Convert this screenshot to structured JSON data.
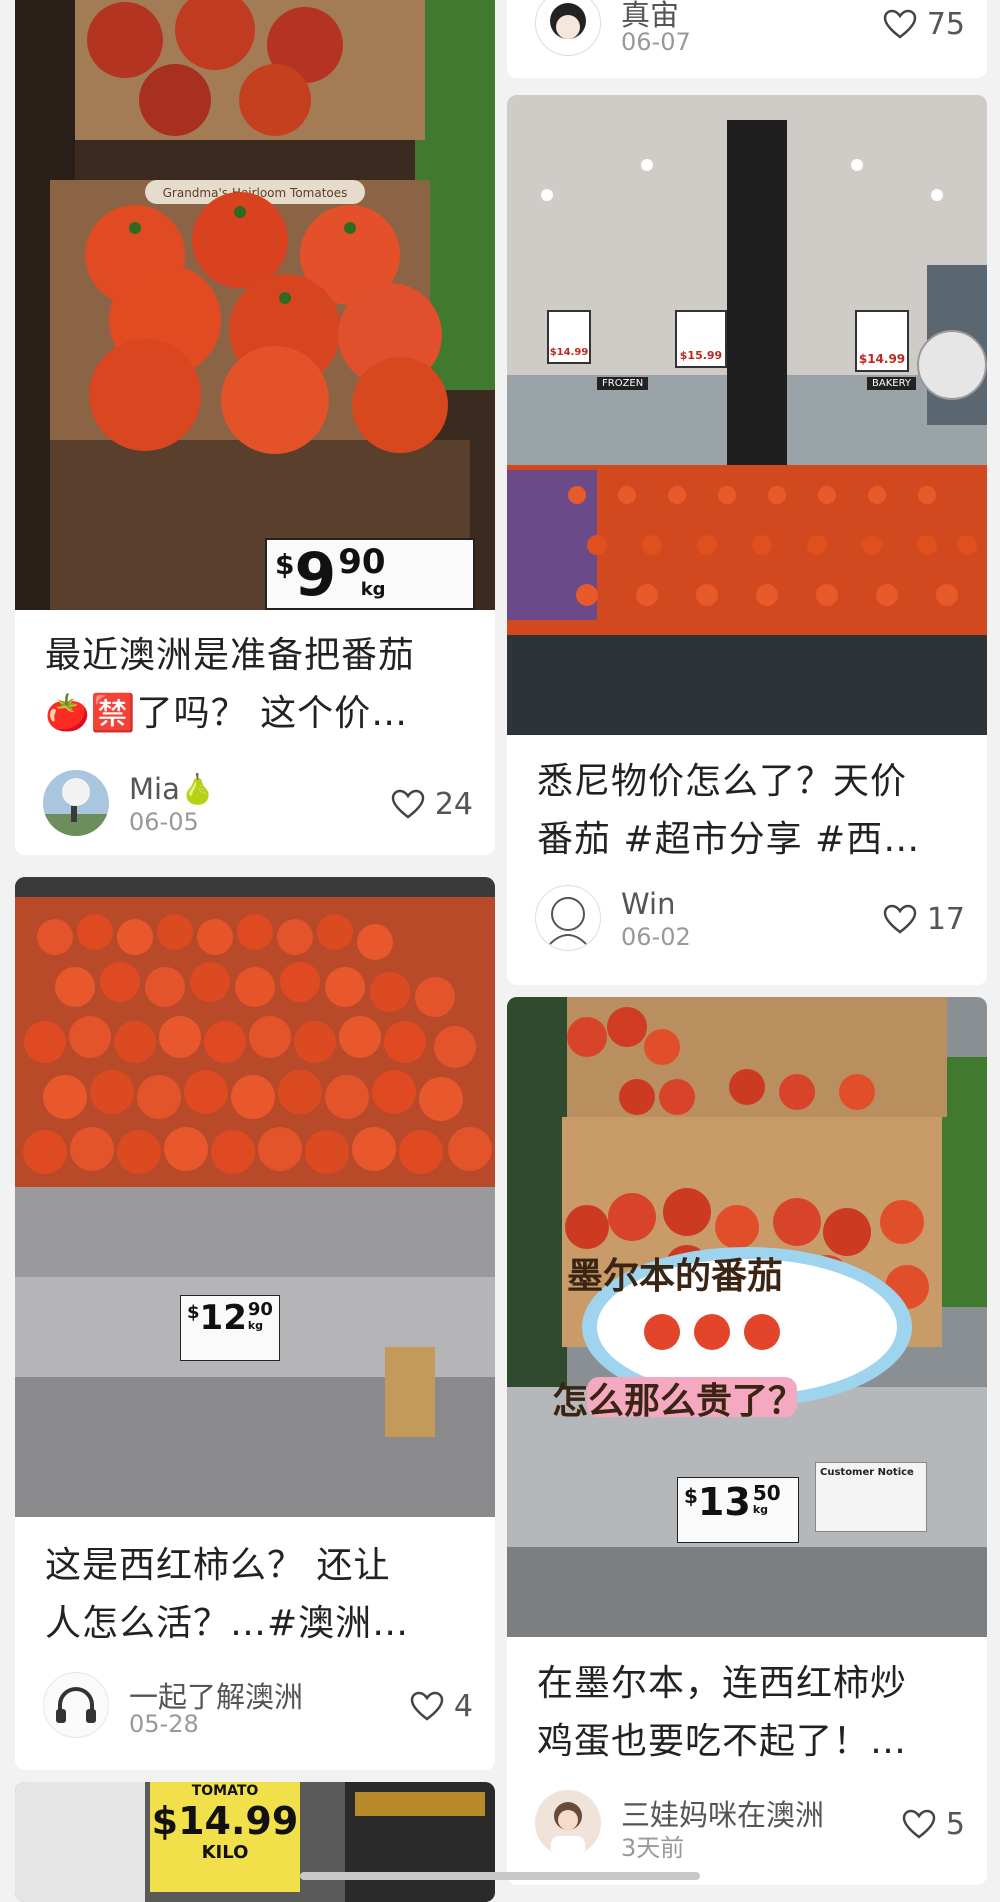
{
  "feed": {
    "left": [
      {
        "title": "最近澳洲是准备把番茄\n🍅🈲了吗？ 这个价…",
        "author": "Mia🍐",
        "date": "06-05",
        "likes": "24",
        "price": {
          "dollar": "$",
          "main": "9",
          "cents": "90",
          "unit": "kg"
        },
        "box_label": "Grandma's Heirloom Tomatoes"
      },
      {
        "title": "这是西红柿么？ 还让\n人怎么活？…#澳洲…",
        "author": "一起了解澳洲",
        "date": "05-28",
        "likes": "4",
        "price": {
          "dollar": "$",
          "main": "12",
          "cents": "90",
          "unit": "kg"
        }
      },
      {
        "price": {
          "label": "TOMATO",
          "main": "$14.99",
          "unit": "KILO"
        }
      }
    ],
    "right": [
      {
        "author": "真宙",
        "date": "06-07",
        "likes": "75"
      },
      {
        "title": "悉尼物价怎么了？天价\n番茄 #超市分享 #西…",
        "author": "Win",
        "date": "06-02",
        "likes": "17",
        "signs": [
          "$14.99",
          "$15.99",
          "$14.99"
        ],
        "store_labels": [
          "FROZEN",
          "BAKERY"
        ]
      },
      {
        "title": "在墨尔本，连西红柿炒\n鸡蛋也要吃不起了！…",
        "author": "三娃妈咪在澳洲",
        "date": "3天前",
        "likes": "5",
        "overlay_line1": "墨尔本的番茄",
        "overlay_line2": "怎么那么贵了？",
        "price": {
          "dollar": "$",
          "main": "13",
          "cents": "50",
          "unit": "kg"
        },
        "notice": "Customer Notice"
      }
    ]
  },
  "icons": {
    "like": "heart-outline-icon"
  },
  "colors": {
    "background": "#f2f2f2",
    "card": "#ffffff",
    "tomato": "#e0461f",
    "text": "#222222",
    "muted": "#999999"
  }
}
